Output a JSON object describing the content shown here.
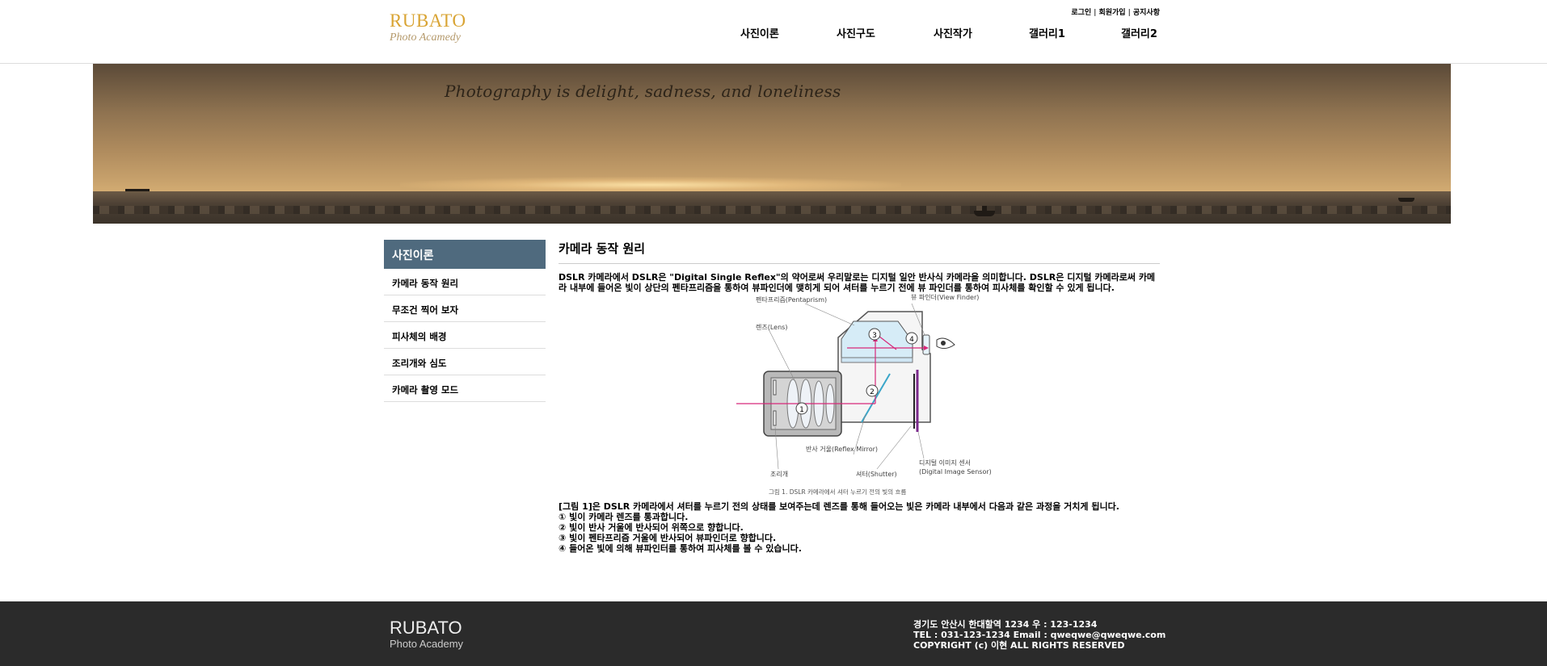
{
  "logo": {
    "main": "RUBATO",
    "sub": "Photo Acamedy"
  },
  "util_links": {
    "login": "로그인",
    "join": "회원가입",
    "notice": "공지사항",
    "sep": "|"
  },
  "gnb": [
    "사진이론",
    "사진구도",
    "사진작가",
    "갤러리1",
    "갤러리2"
  ],
  "banner": {
    "tagline": "Photography is delight, sadness, and loneliness"
  },
  "lnb": {
    "title": "사진이론",
    "items": [
      "카메라 동작 원리",
      "무조건 찍어 보자",
      "피사체의 배경",
      "조리개와 심도",
      "카메라 촬영 모드"
    ]
  },
  "content": {
    "title": "카메라 동작 원리",
    "intro": "DSLR 카메라에서 DSLR은 \"Digital Single Reflex\"의 약어로써 우리말로는 디지털 일안 반사식 카메라을 의미합니다. DSLR은 디지털 카메라로써 카메라 내부에 들어온 빛이 상단의 펜타프리즘을 통하여 뷰파인더에 맺히게 되어 셔터를 누르기 전에 뷰 파인더를 통하여 피사체를 확인할 수 있게 됩니다.",
    "figure": {
      "pentaprism": "펜타프리즘(Pentaprism)",
      "viewfinder": "뷰 파인더(View Finder)",
      "lens": "렌즈(Lens)",
      "mirror": "반사 거울(Reflex Mirror)",
      "aperture": "조리개",
      "shutter": "셔터(Shutter)",
      "sensor1": "디지털 이미지 센서",
      "sensor2": "(Digital Image Sensor)",
      "n1": "1",
      "n2": "2",
      "n3": "3",
      "n4": "4",
      "caption": "그림 1. DSLR 카메라에서 셔터 누르기 전의 빛의 흐름"
    },
    "desc": [
      "[그림 1]은 DSLR 카메라에서 셔터를 누르기 전의 상태를 보여주는데 렌즈를 통해 들어오는 빛은 카메라 내부에서 다음과 같은 과정을 거치게 됩니다.",
      "① 빛이 카메라 렌즈를 통과합니다.",
      "② 빛이 반사 거울에 반사되어 위쪽으로 향합니다.",
      "③ 빛이 펜타프리즘 거울에 반사되어 뷰파인더로 향합니다.",
      "④ 들어온 빛에 의해 뷰파인터를 통하여 피사체를 볼 수 있습니다."
    ]
  },
  "footer": {
    "logo_main": "RUBATO",
    "logo_sub": "Photo Academy",
    "address": "경기도 안산시 한대할역 1234 우 : 123-1234",
    "contact": "TEL : 031-123-1234 Email : qweqwe@qweqwe.com",
    "copyright": "COPYRIGHT (c) 이현 ALL RIGHTS RESERVED"
  }
}
